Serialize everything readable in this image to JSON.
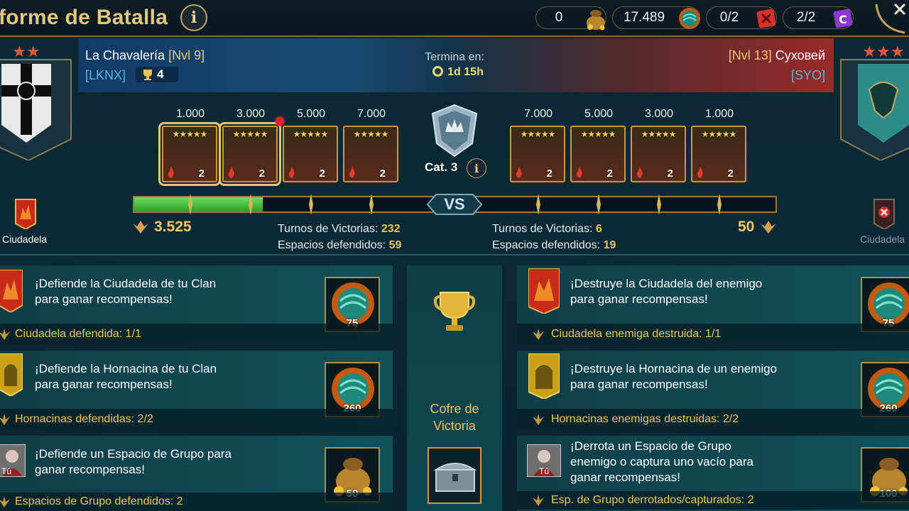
{
  "header": {
    "title": "forme de Batalla"
  },
  "resources": [
    {
      "name": "bag",
      "value": "0"
    },
    {
      "name": "gem",
      "value": "17.489"
    },
    {
      "name": "red-scroll",
      "value": "0/2"
    },
    {
      "name": "purple-scroll",
      "value": "2/2"
    }
  ],
  "left_clan": {
    "name": "La Chavalería",
    "level": "[Nvl 9]",
    "tag": "[LKNX]",
    "trophies": "4"
  },
  "right_clan": {
    "name": "Суховей",
    "level": "[Nvl 13]",
    "tag": "[SYO]"
  },
  "timer": {
    "label": "Termina en:",
    "value": "1d 15h"
  },
  "chests_left": [
    {
      "points": "1.000",
      "count": "2"
    },
    {
      "points": "3.000",
      "count": "2"
    },
    {
      "points": "5.000",
      "count": "2"
    },
    {
      "points": "7.000",
      "count": "2"
    }
  ],
  "chests_right": [
    {
      "points": "7.000",
      "count": "2"
    },
    {
      "points": "5.000",
      "count": "2"
    },
    {
      "points": "3.000",
      "count": "2"
    },
    {
      "points": "1.000",
      "count": "2"
    }
  ],
  "category": "Cat. 3",
  "vs": "VS",
  "progress_fraction": 0.2,
  "left_score": "3.525",
  "right_score": "50",
  "citadel": {
    "left": "Ciudadela",
    "right": "Ciudadela"
  },
  "stats_left": {
    "wins_label": "Turnos de Victorias:",
    "wins": "232",
    "def_label": "Espacios defendidos:",
    "def": "59"
  },
  "stats_right": {
    "wins_label": "Turnos de Victorias:",
    "wins": "6",
    "def_label": "Espacios defendidos:",
    "def": "19"
  },
  "tasks_left": [
    {
      "text1": "¡Defiende la Ciudadela de tu Clan",
      "text2": "para ganar recompensas!",
      "progress": "Ciudadela defendida: 1/1",
      "reward": "75"
    },
    {
      "text1": "¡Defiende la Hornacina de tu Clan",
      "text2": "para ganar recompensas!",
      "progress": "Hornacinas defendidas: 2/2",
      "reward": "260"
    },
    {
      "text1": "¡Defiende un Espacio de Grupo para",
      "text2": "ganar recompensas!",
      "progress": "Espacios de Grupo defendidos: 2",
      "reward": "50"
    }
  ],
  "tasks_right": [
    {
      "text1": "¡Destruye la Ciudadela del enemigo",
      "text2": "para ganar recompensas!",
      "text3": "",
      "progress": "Ciudadela enemiga destruida: 1/1",
      "reward": "75"
    },
    {
      "text1": "¡Destruye la Hornacina de un enemigo",
      "text2": "para ganar recompensas!",
      "text3": "",
      "progress": "Hornacinas enemigas destruidas: 2/2",
      "reward": "260"
    },
    {
      "text1": "¡Derrota un Espacio de Grupo",
      "text2": "enemigo o captura uno vacío para",
      "text3": "ganar recompensas!",
      "progress": "Esp. de Grupo derrotados/capturados: 2",
      "reward": "100"
    }
  ],
  "you_label": "Tú",
  "victory_chest": {
    "line1": "Cofre de",
    "line2": "Victoria"
  }
}
